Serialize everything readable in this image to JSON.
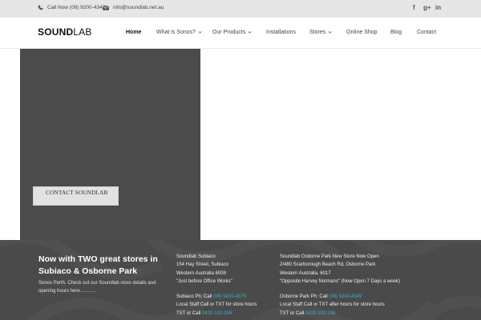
{
  "topbar": {
    "phone_text": "Call Now (08) 9200-4349",
    "email_text": "info@soundlab.net.au",
    "social": [
      {
        "icon": "facebook-icon",
        "glyph": "f"
      },
      {
        "icon": "google-plus-icon",
        "glyph": "g+"
      },
      {
        "icon": "linkedin-icon",
        "glyph": "in"
      }
    ]
  },
  "logo": {
    "bold": "SOUND",
    "light": "LAB"
  },
  "nav": [
    {
      "label": "Home",
      "active": true,
      "dropdown": false
    },
    {
      "label": "What is Sonos?",
      "dropdown": true
    },
    {
      "label": "Our Products",
      "dropdown": true
    },
    {
      "label": "Installations",
      "dropdown": false
    },
    {
      "label": "Stores",
      "dropdown": true
    },
    {
      "label": "Online Shop",
      "dropdown": false
    },
    {
      "label": "Blog",
      "dropdown": false
    },
    {
      "label": "Contact",
      "dropdown": false
    }
  ],
  "hero": {
    "button_label": "CONTACT SOUNDLAB"
  },
  "footer": {
    "title": "Now with TWO great stores in Subiaco & Osborne Park",
    "tagline": "Sonos Perth. Check out our Soundlab store details and opening hours here……….",
    "stores": [
      {
        "name": "Soundlab Subiaco",
        "address1": "154 Hay Street, Subiaco",
        "address2": "Western Australia 6008",
        "note": "\"Just before Office Works\"",
        "ph_prefix": "Subiaco Ph: Call ",
        "ph_number": "(08) 9200-4375",
        "after_hours": "Local Staff Call or TXT for store hours",
        "txt_prefix": "TXT or Call ",
        "txt_number": "0420-102-284"
      },
      {
        "name": "Soundlab Osborne Park New Store Now Open",
        "address1": "2/480 Scarborough Beach Rd, Osborne Park",
        "address2": "Western Australia, 6017",
        "note": "\"Opposite Harvey Normans\" (Now Open 7 Days a week)",
        "ph_prefix": "Osborne Park Ph: Call ",
        "ph_number": "(08) 9200-4349",
        "after_hours": "Local Staff Call or TXT after hours for store hours",
        "txt_prefix": "TXT or Call ",
        "txt_number": "0420-102-298"
      }
    ]
  },
  "colors": {
    "topbar_bg": "#e6e6e6",
    "hero_panel": "#4b4b4b",
    "footer_bg": "#4a4a4a",
    "phone_link": "#2fb8c8"
  }
}
